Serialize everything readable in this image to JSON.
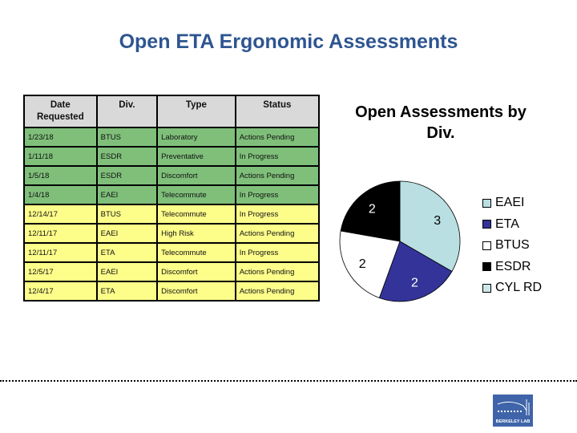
{
  "page": {
    "title": "Open ETA Ergonomic Assessments"
  },
  "table": {
    "headers": [
      "Date Requested",
      "Div.",
      "Type",
      "Status"
    ],
    "header_lines": {
      "date": [
        "Date",
        "Requested"
      ]
    },
    "rows": [
      {
        "date": "1/23/18",
        "div": "BTUS",
        "type": "Laboratory",
        "status": "Actions Pending",
        "row_color": "green"
      },
      {
        "date": "1/11/18",
        "div": "ESDR",
        "type": "Preventative",
        "status": "In Progress",
        "row_color": "green"
      },
      {
        "date": "1/5/18",
        "div": "ESDR",
        "type": "Discomfort",
        "status": "Actions Pending",
        "row_color": "green"
      },
      {
        "date": "1/4/18",
        "div": "EAEI",
        "type": "Telecommute",
        "status": "In Progress",
        "row_color": "green"
      },
      {
        "date": "12/14/17",
        "div": "BTUS",
        "type": "Telecommute",
        "status": "In Progress",
        "row_color": "yellow"
      },
      {
        "date": "12/11/17",
        "div": "EAEI",
        "type": "High Risk",
        "status": "Actions Pending",
        "row_color": "yellow"
      },
      {
        "date": "12/11/17",
        "div": "ETA",
        "type": "Telecommute",
        "status": "In Progress",
        "row_color": "yellow"
      },
      {
        "date": "12/5/17",
        "div": "EAEI",
        "type": "Discomfort",
        "status": "Actions Pending",
        "row_color": "yellow"
      },
      {
        "date": "12/4/17",
        "div": "ETA",
        "type": "Discomfort",
        "status": "Actions Pending",
        "row_color": "yellow"
      }
    ],
    "colors": {
      "header": "#d9d9d9",
      "green": "#7fbf7a",
      "yellow": "#fdfd8a"
    }
  },
  "chart_data": {
    "type": "pie",
    "title": "Open Assessments by Div.",
    "title_lines": [
      "Open Assessments by",
      "Div."
    ],
    "categories": [
      "EAEI",
      "ETA",
      "BTUS",
      "ESDR",
      "CYL RD"
    ],
    "values": [
      3,
      2,
      2,
      2,
      0
    ],
    "colors": [
      "#b9dfe2",
      "#333399",
      "#ffffff",
      "#000000",
      "#cfe6e8"
    ],
    "label_colors": [
      "#000000",
      "#ffffff",
      "#000000",
      "#ffffff",
      "#000000"
    ],
    "data_labels": [
      "3",
      "2",
      "2",
      "2",
      ""
    ],
    "legend_position": "right",
    "start": "12 o'clock, clockwise"
  },
  "footer": {
    "logo_text": "BERKELEY LAB",
    "logo_color": "#3f64a9"
  }
}
